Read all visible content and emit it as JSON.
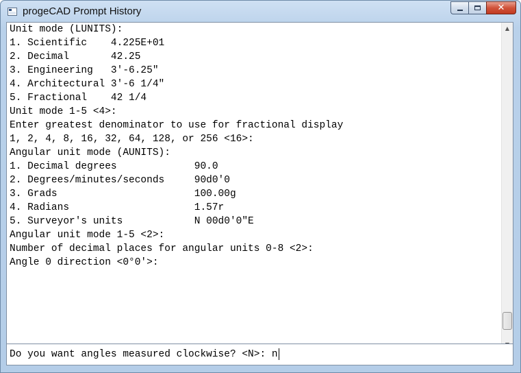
{
  "window": {
    "title": "progeCAD Prompt History",
    "controls": {
      "minimize_icon": "minimize-icon",
      "maximize_icon": "maximize-icon",
      "close_label": "✕",
      "close_color": "#c7432b"
    }
  },
  "history": {
    "lines": [
      "Unit mode (LUNITS):",
      "1. Scientific    4.225E+01",
      "2. Decimal       42.25",
      "3. Engineering   3'-6.25\"",
      "4. Architectural 3'-6 1/4\"",
      "5. Fractional    42 1/4",
      "Unit mode 1-5 <4>:",
      "Enter greatest denominator to use for fractional display",
      "1, 2, 4, 8, 16, 32, 64, 128, or 256 <16>:",
      "Angular unit mode (AUNITS):",
      "1. Decimal degrees             90.0",
      "2. Degrees/minutes/seconds     90d0'0",
      "3. Grads                       100.00g",
      "4. Radians                     1.57r",
      "5. Surveyor's units            N 00d0'0\"E",
      "Angular unit mode 1-5 <2>:",
      "Number of decimal places for angular units 0-8 <2>:",
      "Angle 0 direction <0°0'>:"
    ],
    "scroll_position": 0.97
  },
  "prompt": {
    "text": "Do you want angles measured clockwise? <N>: n"
  }
}
